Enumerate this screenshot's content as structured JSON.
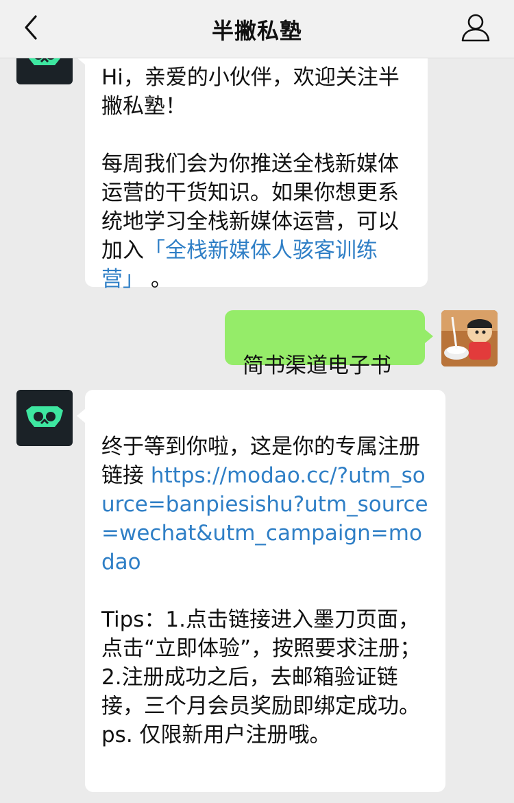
{
  "header": {
    "title": "半撇私塾",
    "back_icon": "chevron-left-icon",
    "profile_icon": "user-icon"
  },
  "messages": [
    {
      "from": "bot",
      "part1": "Hi，亲爱的小伙伴，欢迎关注半撇私塾！\n\n每周我们会为你推送全栈新媒体运营的干货知识。如果你想更系统地学习全栈新媒体运营，可以加入",
      "link": "「全栈新媒体人骇客训练营」",
      "part2": "  。"
    },
    {
      "from": "user",
      "text": "简书渠道电子书"
    },
    {
      "from": "bot",
      "part1": "终于等到你啦，这是你的专属注册链接  ",
      "link": "https://modao.cc/?utm_source=banpiesishu?utm_source=wechat&utm_campaign=modao",
      "part2": "\n\nTips：1.点击链接进入墨刀页面，点击“立即体验”，按照要求注册；\n2.注册成功之后，去邮箱验证链接，三个月会员奖励即绑定成功。\nps. 仅限新用户注册哦。"
    }
  ],
  "colors": {
    "background": "#ebebeb",
    "user_bubble": "#95ec69",
    "bot_bubble": "#ffffff",
    "link": "#2f7fc6",
    "bot_avatar_bg": "#1b2227",
    "bot_avatar_accent": "#3ee6a0"
  }
}
